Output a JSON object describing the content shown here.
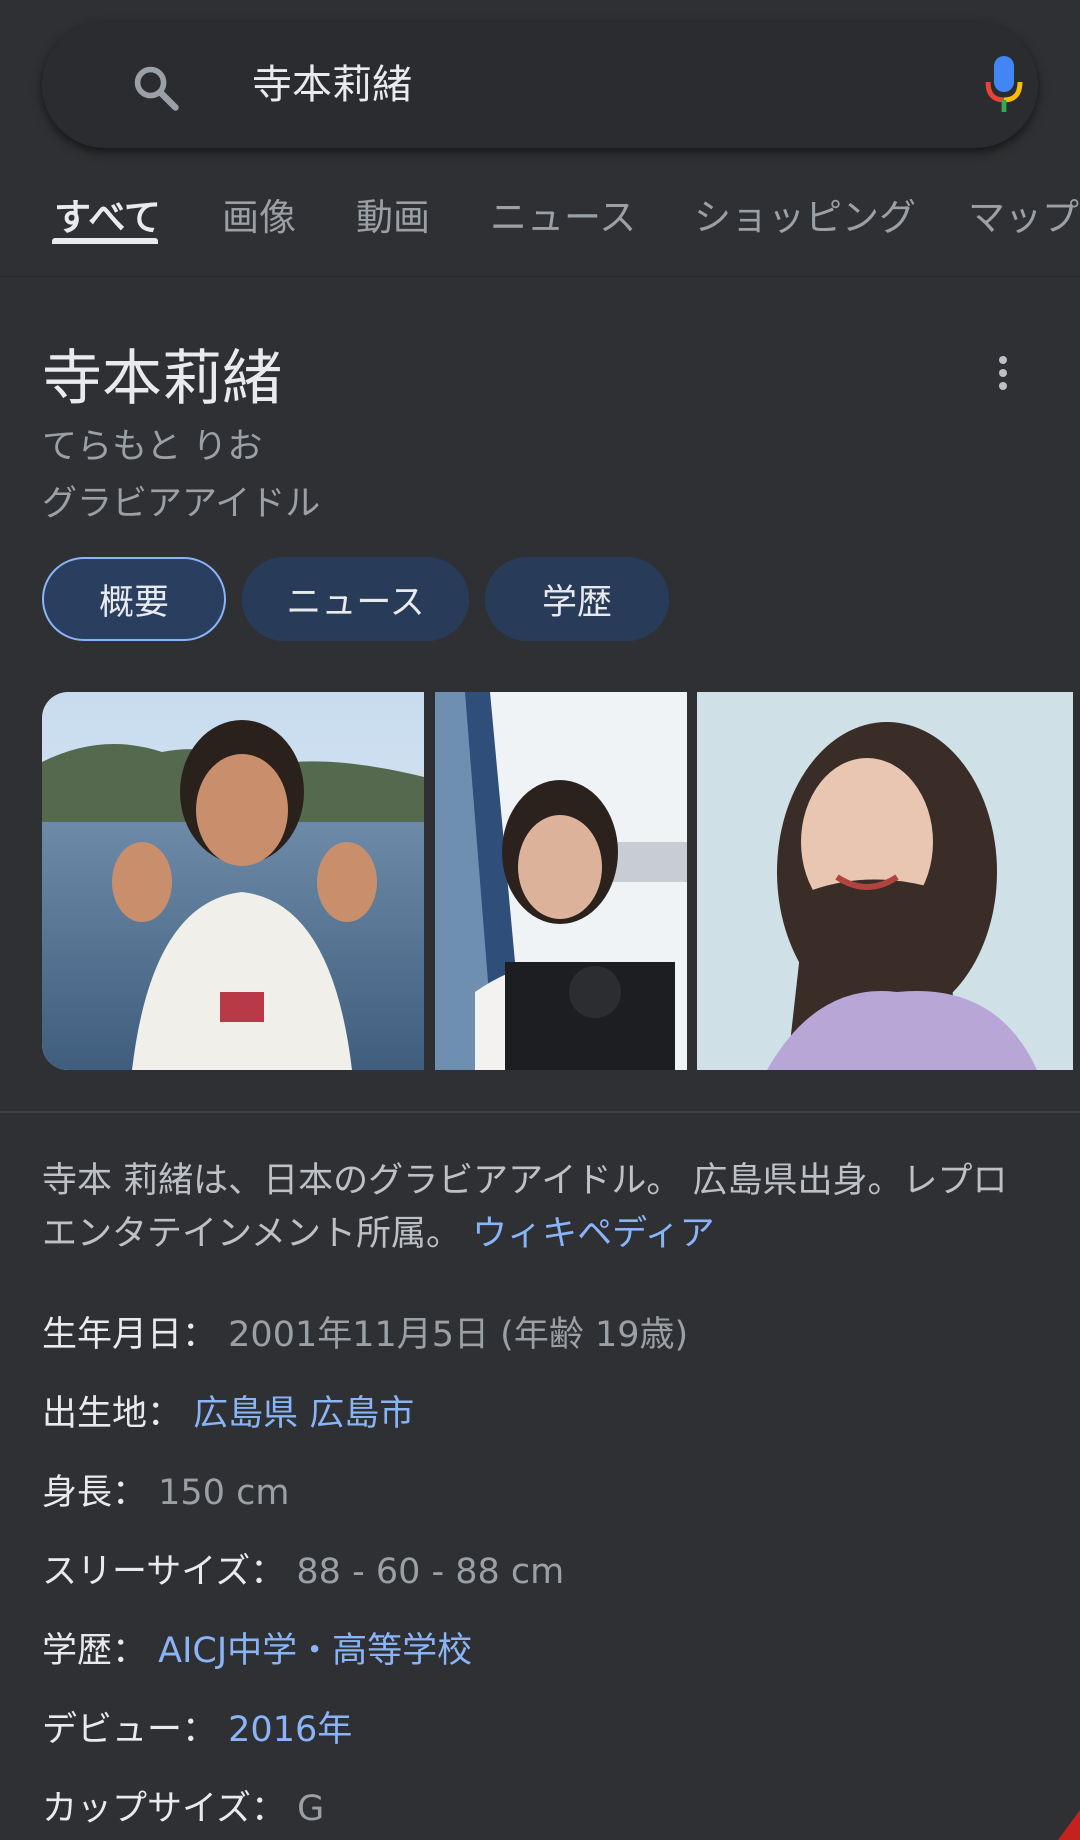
{
  "search": {
    "query": "寺本莉緒"
  },
  "tabs": [
    {
      "label": "すべて",
      "active": true
    },
    {
      "label": "画像"
    },
    {
      "label": "動画"
    },
    {
      "label": "ニュース"
    },
    {
      "label": "ショッピング"
    },
    {
      "label": "マップ"
    }
  ],
  "panel": {
    "title": "寺本莉緒",
    "reading": "てらもと りお",
    "description": "グラビアアイドル",
    "chips": [
      "概要",
      "ニュース",
      "学歴"
    ]
  },
  "about": {
    "text": "寺本 莉緒は、日本のグラビアアイドル。 広島県出身。レプロエンタテインメント所属。",
    "source_link": "ウィキペディア"
  },
  "facts": [
    {
      "label": "生年月日：",
      "value": "2001年11月5日 (年齢 19歳)",
      "is_link": false
    },
    {
      "label": "出生地：",
      "value": "広島県 広島市",
      "is_link": true
    },
    {
      "label": "身長：",
      "value": "150 cm",
      "is_link": false
    },
    {
      "label": "スリーサイズ：",
      "value": "88 - 60 - 88 cm",
      "is_link": false
    },
    {
      "label": "学歴：",
      "value": "AICJ中学・高等学校",
      "is_link": true
    },
    {
      "label": "デビュー：",
      "value": "2016年",
      "is_link": true
    },
    {
      "label": "カップサイズ：",
      "value": "G",
      "is_link": false
    }
  ],
  "colors": {
    "background": "#303134",
    "link": "#8ab4f8",
    "chip": "#283c5a"
  },
  "icons": [
    "search-icon",
    "microphone-icon",
    "more-vert-icon"
  ]
}
